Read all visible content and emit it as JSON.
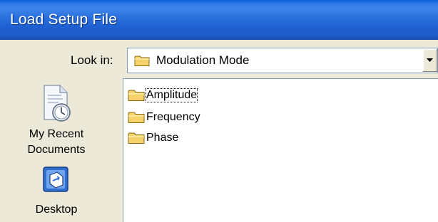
{
  "window": {
    "title": "Load Setup File"
  },
  "look_in": {
    "label": "Look in:",
    "selected_value": "Modulation Mode",
    "icon": "folder-icon"
  },
  "places_bar": {
    "items": [
      {
        "label_line1": "My Recent",
        "label_line2": "Documents",
        "icon": "recent-documents-icon"
      },
      {
        "label_line1": "Desktop",
        "icon": "desktop-icon"
      }
    ]
  },
  "file_list": {
    "items": [
      {
        "name": "Amplitude",
        "type": "folder",
        "focused": true
      },
      {
        "name": "Frequency",
        "type": "folder",
        "focused": false
      },
      {
        "name": "Phase",
        "type": "folder",
        "focused": false
      }
    ]
  },
  "colors": {
    "titlebar": "#1D5FD1",
    "dialog_background": "#ECE9D8",
    "list_background": "#FFFFFF",
    "folder_yellow": "#F6D26A"
  }
}
